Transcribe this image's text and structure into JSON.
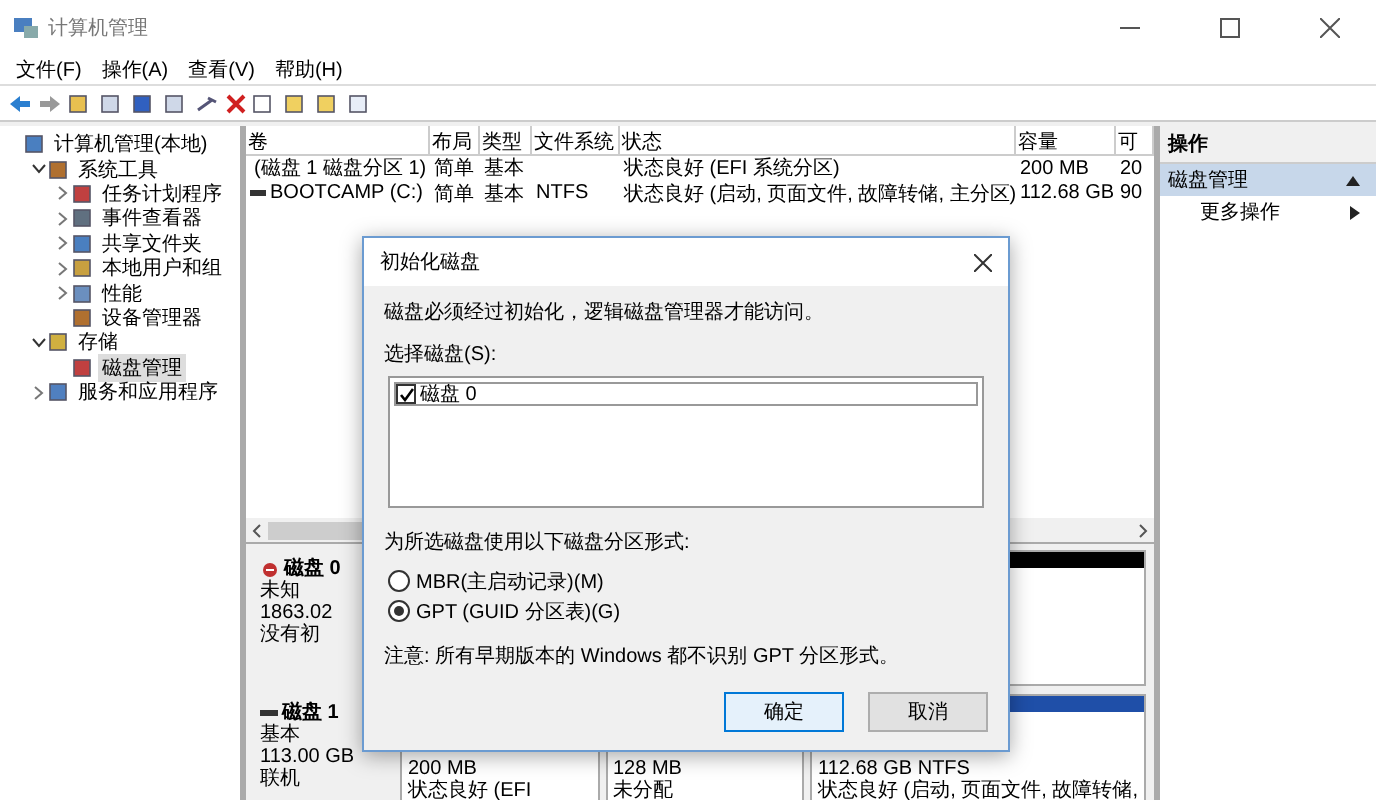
{
  "window": {
    "title": "计算机管理"
  },
  "menu": [
    "文件(F)",
    "操作(A)",
    "查看(V)",
    "帮助(H)"
  ],
  "tree": [
    {
      "label": "计算机管理(本地)",
      "selected": false,
      "children": [
        {
          "label": "系统工具",
          "expanded": true,
          "selected": false,
          "children": [
            {
              "label": "任务计划程序",
              "expanded": false,
              "selected": false
            },
            {
              "label": "事件查看器",
              "expanded": false,
              "selected": false
            },
            {
              "label": "共享文件夹",
              "expanded": false,
              "selected": false
            },
            {
              "label": "本地用户和组",
              "expanded": false,
              "selected": false
            },
            {
              "label": "性能",
              "expanded": false,
              "selected": false
            },
            {
              "label": "设备管理器",
              "selected": false
            }
          ]
        },
        {
          "label": "存储",
          "expanded": true,
          "selected": false,
          "children": [
            {
              "label": "磁盘管理",
              "selected": true
            }
          ]
        },
        {
          "label": "服务和应用程序",
          "expanded": false,
          "selected": false
        }
      ]
    }
  ],
  "volumes": {
    "columns": [
      "卷",
      "布局",
      "类型",
      "文件系统",
      "状态",
      "容量",
      "可"
    ],
    "rows": [
      [
        "(磁盘 1 磁盘分区 1)",
        "简单",
        "基本",
        "",
        "状态良好 (EFI 系统分区)",
        "200 MB",
        "20"
      ],
      [
        "BOOTCAMP (C:)",
        "简单",
        "基本",
        "NTFS",
        "状态良好 (启动, 页面文件, 故障转储, 主分区)",
        "112.68 GB",
        "90"
      ]
    ]
  },
  "disks": [
    {
      "name": "磁盘 0",
      "kind": "uninitialized",
      "lines": [
        "未知",
        "1863.02",
        "没有初"
      ],
      "partitions": [
        {
          "kind": "unallocated"
        }
      ]
    },
    {
      "name": "磁盘 1",
      "kind": "basic",
      "lines": [
        "基本",
        "113.00 GB",
        "联机"
      ],
      "partitions": [
        {
          "kind": "primary",
          "lines": [
            "200 MB",
            "状态良好 (EFI"
          ]
        },
        {
          "kind": "unallocated",
          "lines": [
            "128 MB",
            "未分配"
          ]
        },
        {
          "kind": "primary",
          "lines": [
            "112.68 GB NTFS",
            "状态良好 (启动, 页面文件, 故障转储,"
          ]
        }
      ]
    }
  ],
  "actions": {
    "header": "操作",
    "items": [
      {
        "label": "磁盘管理",
        "kind": "section",
        "selected": true
      },
      {
        "label": "更多操作",
        "kind": "submenu",
        "selected": false
      }
    ]
  },
  "dialog": {
    "title": "初始化磁盘",
    "message": "磁盘必须经过初始化，逻辑磁盘管理器才能访问。",
    "list_label": "选择磁盘(S):",
    "disks": [
      {
        "label": "磁盘 0",
        "checked": true
      }
    ],
    "format_label": "为所选磁盘使用以下磁盘分区形式:",
    "options": [
      {
        "label": "MBR(主启动记录)(M)",
        "selected": false
      },
      {
        "label": "GPT (GUID 分区表)(G)",
        "selected": true
      }
    ],
    "note": "注意: 所有早期版本的 Windows 都不识别 GPT 分区形式。",
    "buttons": [
      {
        "label": "确定",
        "default": true
      },
      {
        "label": "取消",
        "default": false
      }
    ]
  }
}
